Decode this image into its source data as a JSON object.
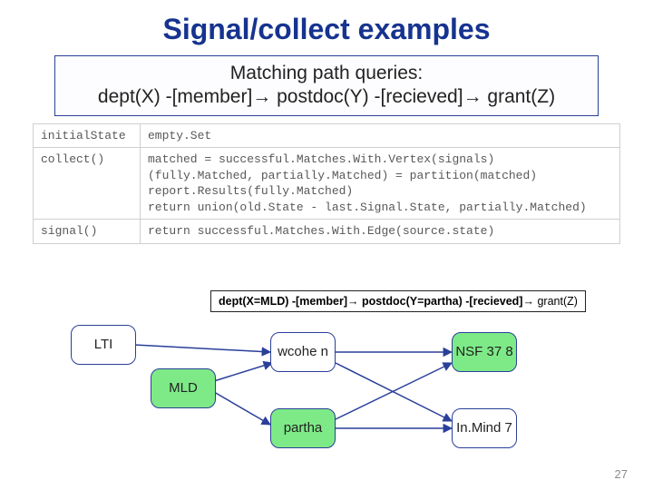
{
  "title": "Signal/collect examples",
  "query_box": {
    "line1": "Matching path queries:",
    "line2_a": "dept(X) -[member]",
    "line2_b": " postdoc(Y) -[recieved]",
    "line2_c": " grant(Z)"
  },
  "code_table": {
    "row0": {
      "label": "initialState",
      "body": "empty.Set"
    },
    "row1": {
      "label": "collect()",
      "body": "matched = successful.Matches.With.Vertex(signals)\n(fully.Matched, partially.Matched) = partition(matched)\nreport.Results(fully.Matched)\nreturn union(old.State - last.Signal.State, partially.Matched)"
    },
    "row2": {
      "label": "signal()",
      "body": "return successful.Matches.With.Edge(source.state)"
    }
  },
  "match_box": {
    "p1": "dept(X=MLD) -[member]",
    "p2": " postdoc(Y=partha) -[recieved]",
    "p3": " grant(Z)"
  },
  "nodes": {
    "lti": {
      "label": "LTI"
    },
    "mld": {
      "label": "MLD"
    },
    "wcohen": {
      "label": "wcohe n"
    },
    "partha": {
      "label": "partha"
    },
    "nsf378": {
      "label": "NSF 37 8"
    },
    "inmind": {
      "label": "In.Mind 7"
    }
  },
  "page_number": "27"
}
